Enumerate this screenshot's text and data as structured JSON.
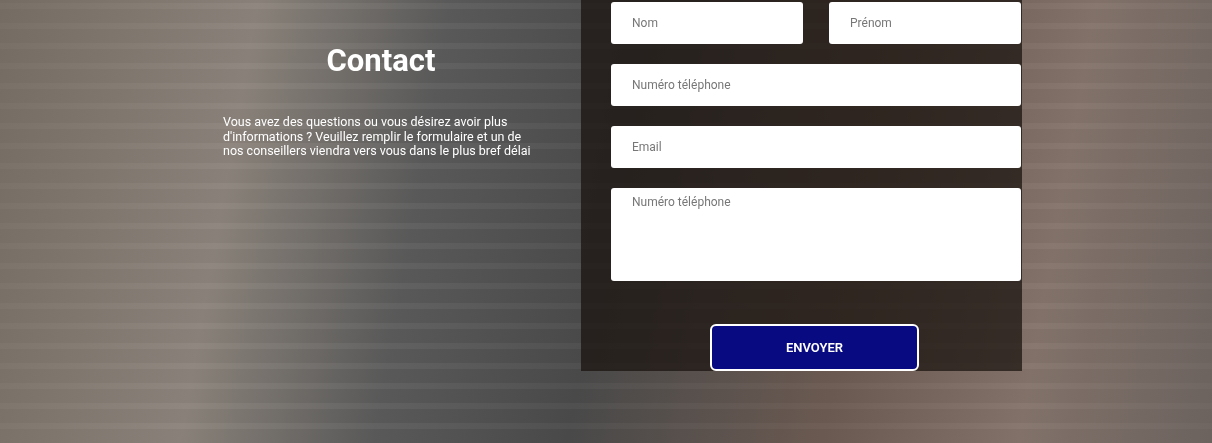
{
  "title": "Contact",
  "description": "Vous avez des questions ou vous désirez avoir plus d'informations ? Veuillez remplir le formulaire et un de nos conseillers viendra vers vous dans le plus bref délai",
  "form": {
    "fields": [
      {
        "kind": "half",
        "placeholder": "Nom"
      },
      {
        "kind": "half",
        "placeholder": "Prénom"
      },
      {
        "kind": "full",
        "placeholder": "Numéro téléphone"
      },
      {
        "kind": "full",
        "placeholder": "Email"
      },
      {
        "kind": "textarea",
        "placeholder": "Numéro téléphone"
      }
    ],
    "submit": "ENVOYER"
  }
}
